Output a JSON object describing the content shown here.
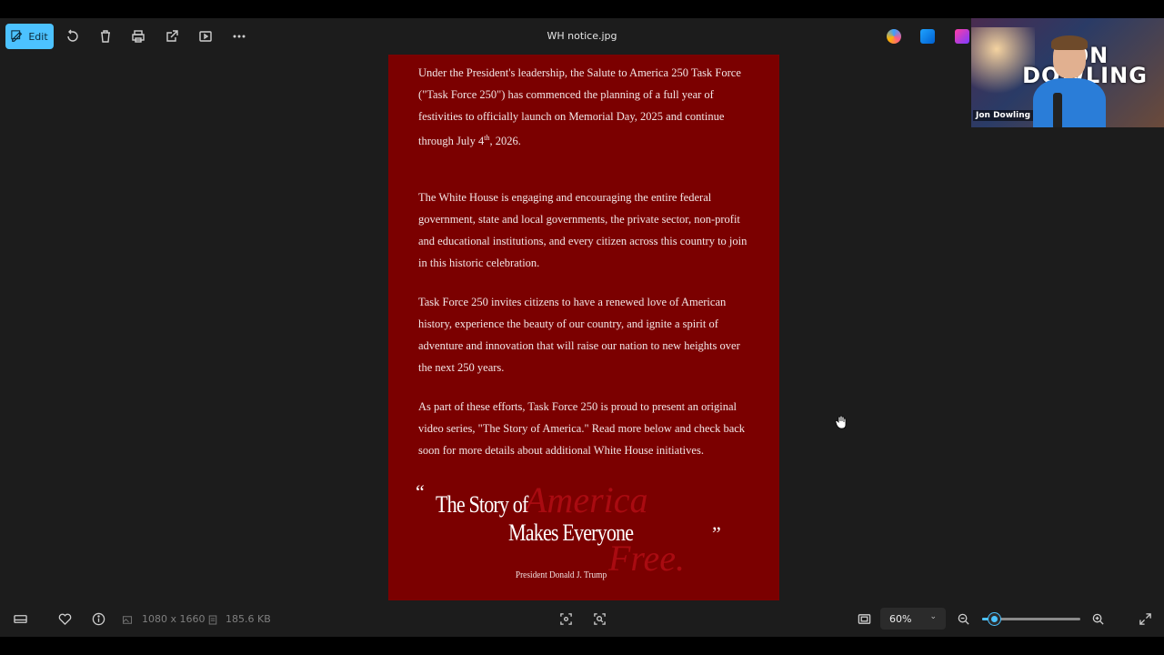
{
  "toolbar": {
    "edit_label": "Edit",
    "file_name": "WH notice.jpg",
    "icons": [
      "rotate-icon",
      "delete-icon",
      "print-icon",
      "share-icon",
      "slideshow-icon",
      "more-icon"
    ],
    "app_icons": [
      "copilot-icon",
      "photos-editor-icon",
      "designer-icon"
    ]
  },
  "webcam": {
    "brand_text_1": "JON",
    "brand_text_2": "DOWLING",
    "name_tag": "Jon Dowling"
  },
  "document": {
    "paragraphs": [
      "Under the President's leadership, the Salute to America 250 Task Force (\"Task Force 250\") has commenced the planning of a full year of festivities to officially launch on Memorial Day, 2025 and continue through July 4",
      "The White House is engaging and encouraging the entire federal government, state and local governments, the private sector, non-profit and educational institutions, and every citizen across this country to join in this historic celebration.",
      "Task Force 250 invites citizens to have a renewed love of American history, experience the beauty of our country, and ignite a spirit of adventure and innovation that will raise our nation to new heights over the next 250 years.",
      "As part of these efforts, Task Force 250 is proud to present an original video series, \"The Story of America.\" Read more below and check back soon for more details about additional White House initiatives."
    ],
    "p1_sup": "th",
    "p1_tail": ", 2026.",
    "quote_open": "“",
    "quote_close": "”",
    "quote_line_1": "The Story of",
    "quote_line_2": "Makes Everyone",
    "quote_script_1": "America",
    "quote_script_2": "Free.",
    "signature": "President Donald J. Trump"
  },
  "status": {
    "dimensions": "1080 x 1660",
    "file_size": "185.6 KB",
    "zoom_value": "60%",
    "zoom_slider_fraction": 0.12
  },
  "colors": {
    "accent": "#4cc2ff",
    "document_bg": "#7b0000",
    "script_red": "#b20d14"
  }
}
